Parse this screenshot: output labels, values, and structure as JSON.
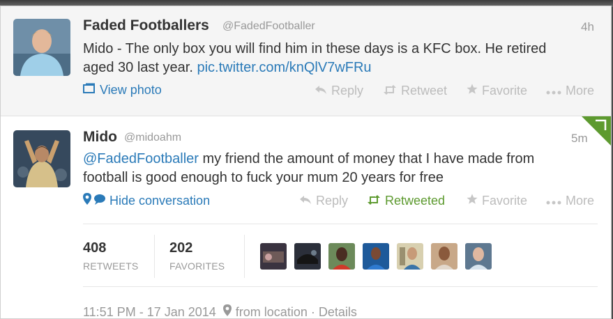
{
  "tweets": [
    {
      "name": "Faded Footballers",
      "handle": "@FadedFootballer",
      "time": "4h",
      "text_line1": "Mido - The only box you will find him in these days is a KFC box. He retired",
      "text_line2_prefix": "aged 30 last year. ",
      "text_line2_link": "pic.twitter.com/knQlV7wFRu",
      "view_photo_label": "View photo",
      "actions": {
        "reply": "Reply",
        "retweet": "Retweet",
        "favorite": "Favorite",
        "more": "More"
      }
    },
    {
      "name": "Mido",
      "handle": "@midoahm",
      "time": "5m",
      "text_line1_mention": "@FadedFootballer",
      "text_line1_rest": " my friend the amount of money that I have made from",
      "text_line2": "football is good enough to fuck  your mum 20 years for free",
      "hide_conversation_label": "Hide conversation",
      "actions": {
        "reply": "Reply",
        "retweeted": "Retweeted",
        "favorite": "Favorite",
        "more": "More"
      },
      "stats": {
        "retweets_count": "408",
        "retweets_label": "RETWEETS",
        "favorites_count": "202",
        "favorites_label": "FAVORITES"
      },
      "timestamp": "11:51 PM - 17 Jan 2014",
      "location": "from location",
      "details": "Details"
    }
  ],
  "colors": {
    "link": "#2a7ab8",
    "retweeted_green": "#5d9a2f",
    "muted_grey": "#bcbcbc",
    "text": "#333333"
  }
}
